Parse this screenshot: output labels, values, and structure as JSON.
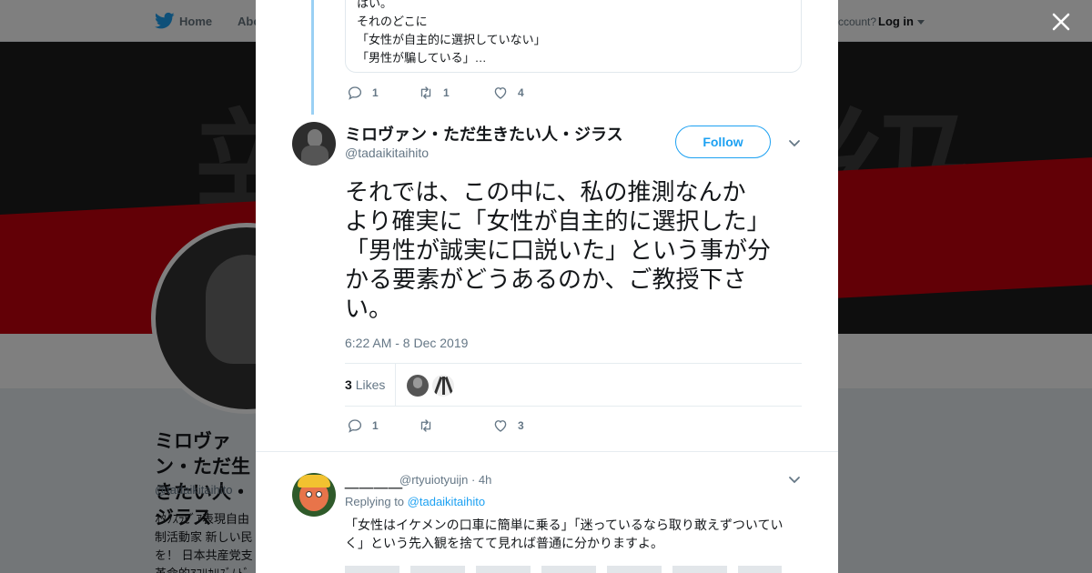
{
  "nav": {
    "home": "Home",
    "about": "Abo",
    "account_prompt": "ccount?",
    "login": "Log in"
  },
  "profile": {
    "name": "ミロヴァン・ただ生きたい人・ジラス",
    "handle": "@tadaikitaihito",
    "bio": "ｵﾀｸｽﾗﾋﾞｱ表現自由 制活動家 新しい民 を！ 日本共産党支 革命的ｱﾌﾘｶﾘｽﾞﾑﾄﾞ"
  },
  "banner": {
    "char_left": "新",
    "char_right": "級"
  },
  "quoted_tweet": {
    "lines": [
      "はい。",
      "それのどこに",
      "「女性が自主的に選択していない」",
      "「男性が騙している」…"
    ],
    "actions": {
      "replies": "1",
      "retweets": "1",
      "likes": "4"
    }
  },
  "main_tweet": {
    "author_name": "ミロヴァン・ただ生きたい人・ジラス",
    "author_handle": "@tadaikitaihito",
    "follow_label": "Follow",
    "text_lines": [
      "それでは、この中に、私の推測なんか",
      "より確実に「女性が自主的に選択した」",
      "「男性が誠実に口説いた」という事が分",
      "かる要素がどうあるのか、ご教授下さ",
      "い。"
    ],
    "timestamp": "6:22 AM - 8 Dec 2019",
    "likes_count": "3",
    "likes_label": "Likes",
    "actions": {
      "replies": "1",
      "retweets": "",
      "likes": "3"
    }
  },
  "reply_tweet": {
    "author_name": "＿＿＿＿",
    "author_handle": "@rtyuiotyuijn",
    "time": "· 4h",
    "replying_prefix": "Replying to",
    "replying_to": "@tadaikitaihito",
    "text_lines": [
      "「女性はイケメンの口車に簡単に乗る」「迷っているなら取り敢えずついてい",
      "く」という先入観を捨てて見れば普通に分かりますよ。"
    ]
  },
  "colors": {
    "accent": "#1da1f2",
    "thread_line": "#9ad0f4",
    "muted_text": "#657786",
    "banner_red": "#c4000d"
  },
  "icons": [
    "twitter-bird-icon",
    "caret-down-icon",
    "close-icon",
    "reply-icon",
    "retweet-icon",
    "heart-icon",
    "chevron-down-icon"
  ]
}
